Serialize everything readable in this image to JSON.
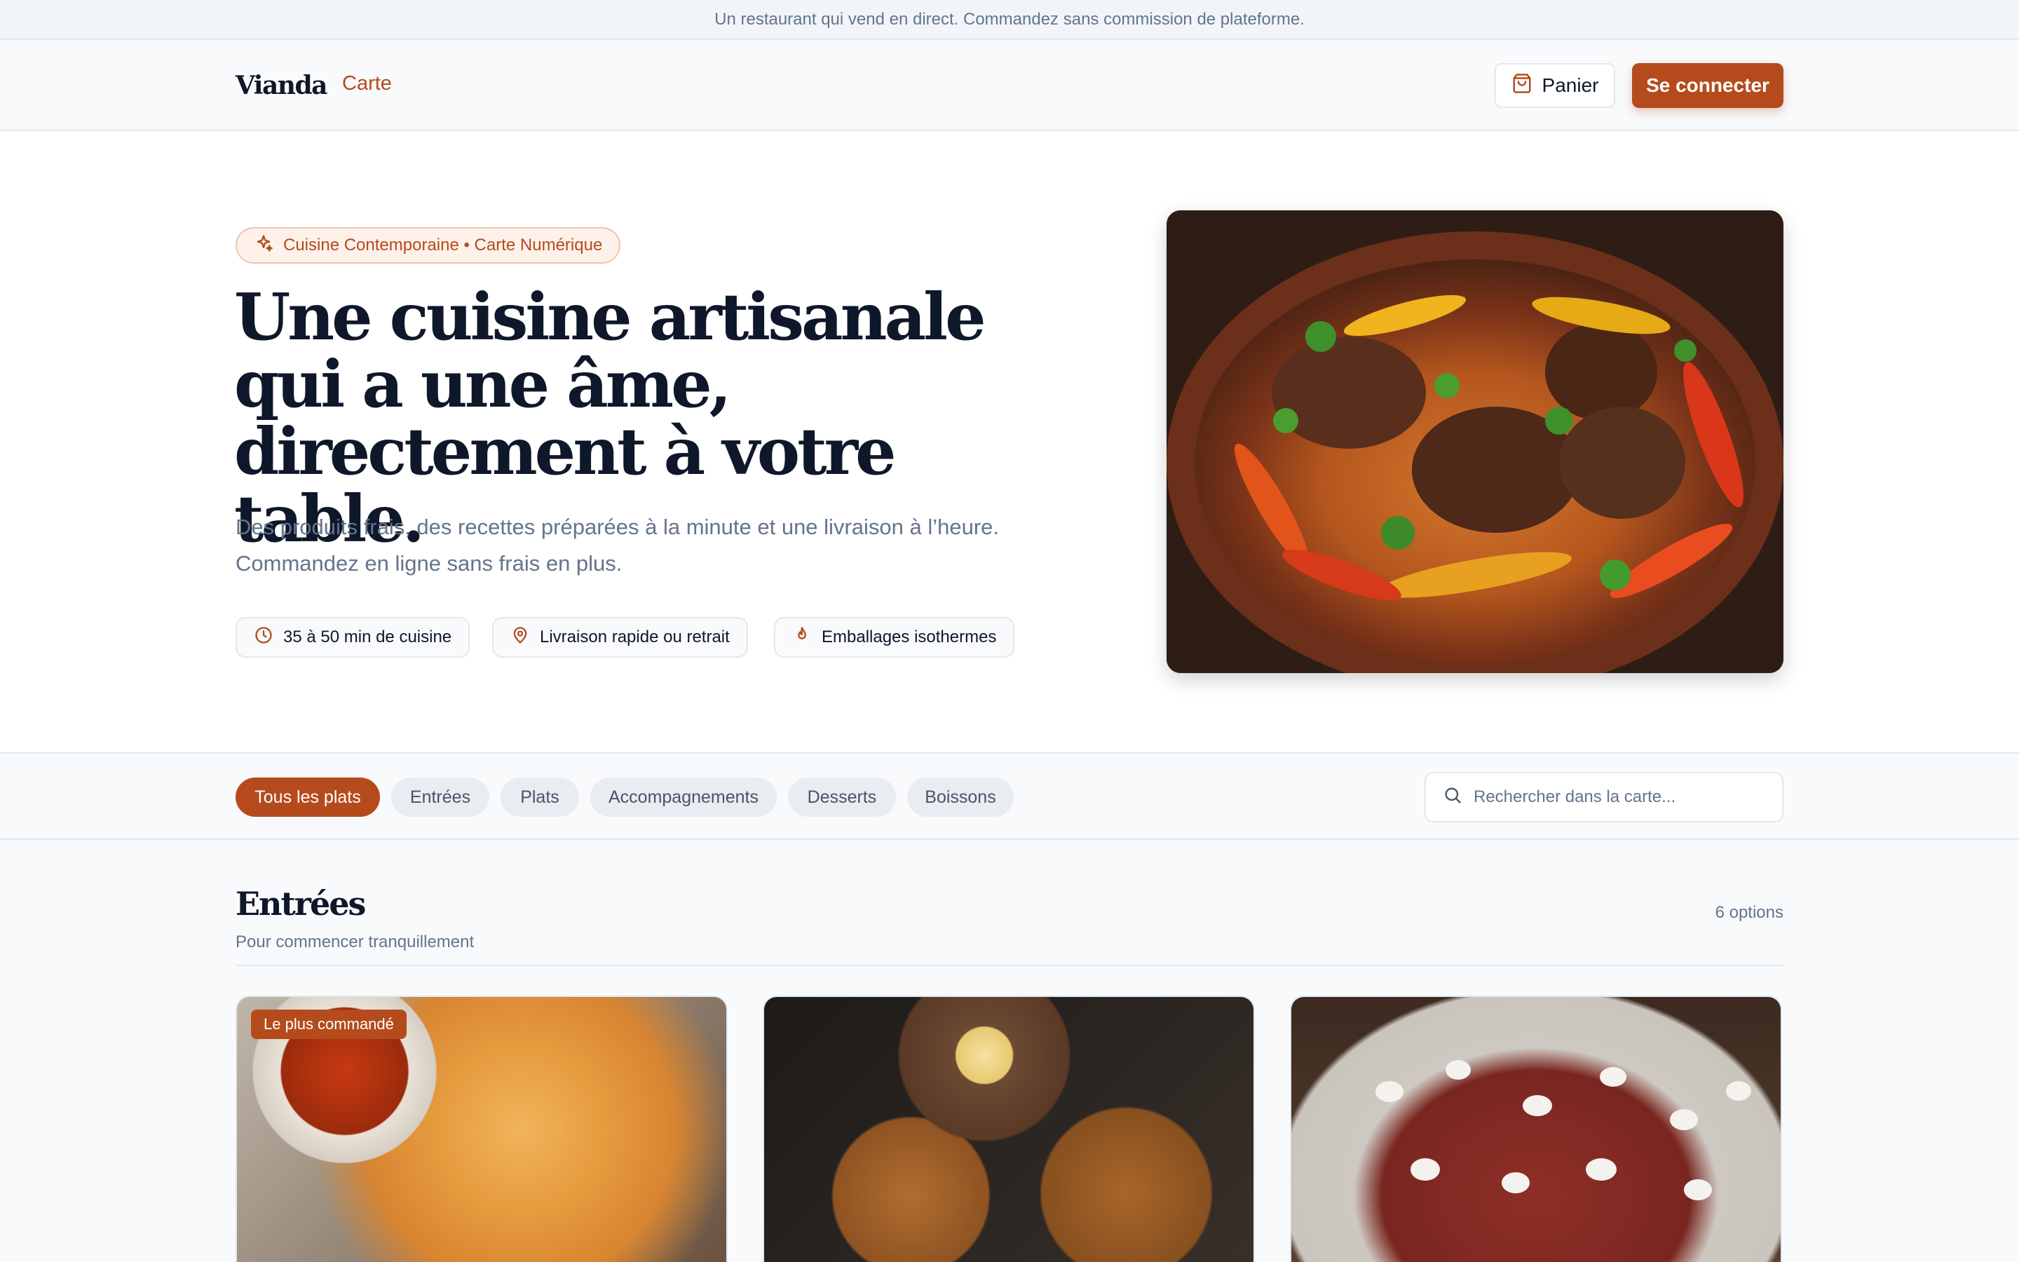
{
  "announcement": "Un restaurant qui vend en direct. Commandez sans commission de plateforme.",
  "header": {
    "logo": "Vianda",
    "nav_carte": "Carte",
    "cart_label": "Panier",
    "login_label": "Se connecter"
  },
  "hero": {
    "badge": "Cuisine Contemporaine • Carte Numérique",
    "title_line1": "Une cuisine artisanale",
    "title_line2": "qui a une âme,",
    "title_line3": "directement à votre table.",
    "subtitle_line1": "Des produits frais, des recettes préparées à la minute et une livraison à l’heure.",
    "subtitle_line2": "Commandez en ligne sans frais en plus.",
    "features": [
      {
        "label": "35 à 50 min de cuisine",
        "icon": "clock-icon"
      },
      {
        "label": "Livraison rapide ou retrait",
        "icon": "map-pin-icon"
      },
      {
        "label": "Emballages isothermes",
        "icon": "flame-icon"
      }
    ]
  },
  "filters": {
    "categories": [
      "Tous les plats",
      "Entrées",
      "Plats",
      "Accompagnements",
      "Desserts",
      "Boissons"
    ],
    "active": "Tous les plats",
    "search_placeholder": "Rechercher dans la carte..."
  },
  "section": {
    "title": "Entrées",
    "subtitle": "Pour commencer tranquillement",
    "count": "6 options",
    "cards": [
      {
        "badge": "Le plus commandé"
      },
      {
        "badge": ""
      },
      {
        "badge": ""
      }
    ]
  },
  "colors": {
    "accent": "#b54b1c",
    "text": "#0f172a",
    "muted": "#64748b"
  }
}
